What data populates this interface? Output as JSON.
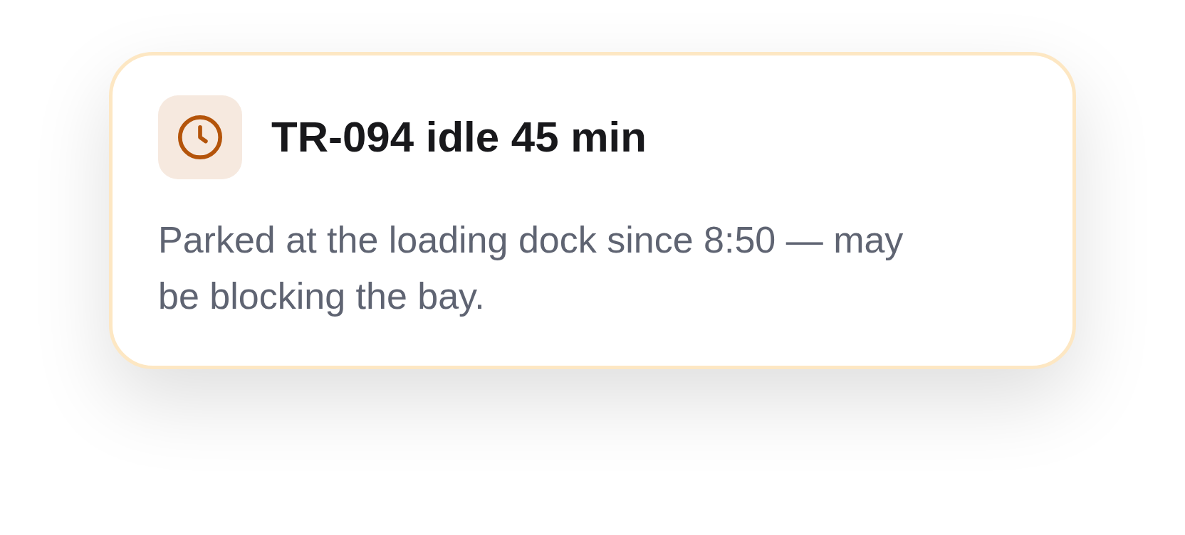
{
  "alert": {
    "title": "TR-094 idle 45 min",
    "message": "Parked at the loading dock since 8:50 — may be blocking the bay."
  }
}
